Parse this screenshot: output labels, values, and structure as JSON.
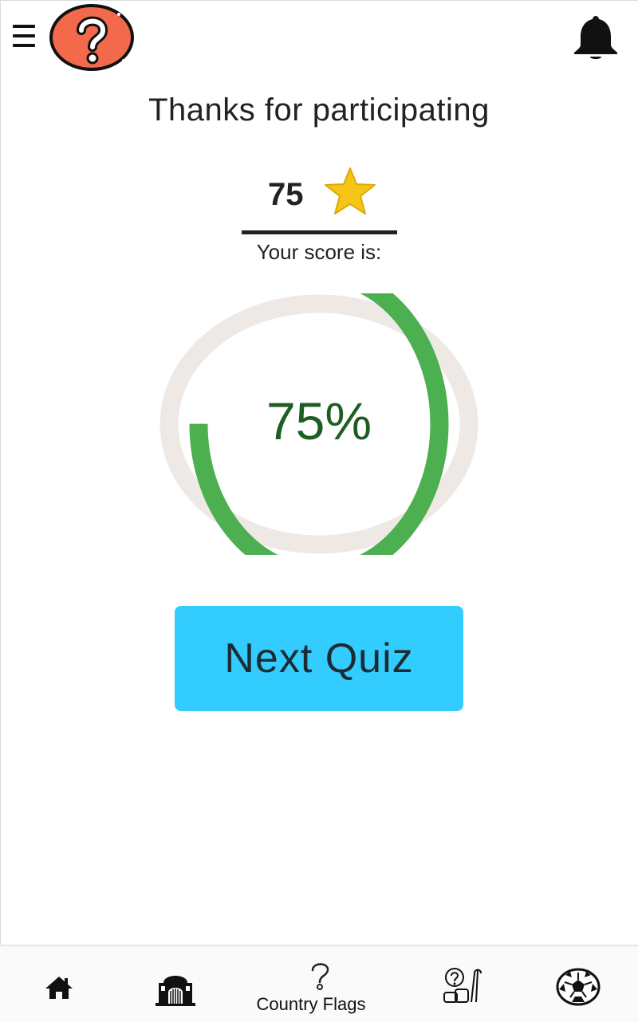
{
  "header": {
    "menu_icon": "hamburger-menu-icon",
    "logo_icon": "question-mark-logo-icon",
    "notification_icon": "bell-icon"
  },
  "result": {
    "title": "Thanks for participating",
    "score": "75",
    "score_icon": "star-icon",
    "score_label": "Your score is:",
    "progress_percent": 75,
    "progress_text": "75%"
  },
  "actions": {
    "next_label": "Next Quiz"
  },
  "bottom_nav": {
    "items": [
      {
        "icon": "home-icon",
        "label": ""
      },
      {
        "icon": "monument-icon",
        "label": ""
      },
      {
        "icon": "question-mark-icon",
        "label": "Country Flags"
      },
      {
        "icon": "quiz-props-icon",
        "label": ""
      },
      {
        "icon": "soccer-ball-icon",
        "label": ""
      }
    ]
  },
  "colors": {
    "progress_fill": "#4caf50",
    "progress_track": "#efe9e6",
    "progress_text": "#1e5e22",
    "button_bg": "#33ccff",
    "logo_bg": "#f26a4b",
    "star": "#f5c518"
  }
}
